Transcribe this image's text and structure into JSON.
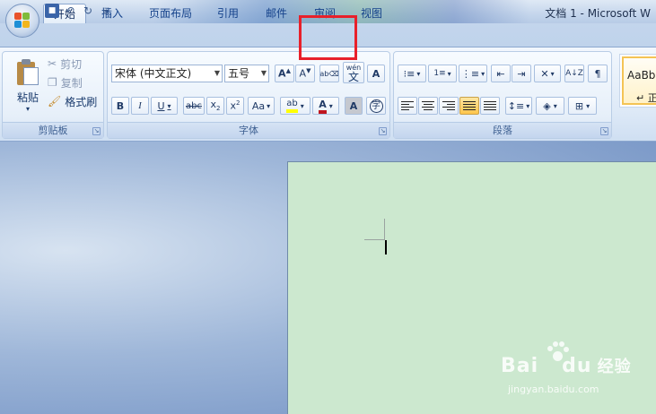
{
  "window": {
    "title": "文档 1 - Microsoft W"
  },
  "tabs": [
    {
      "label": "开始",
      "active": true
    },
    {
      "label": "插入"
    },
    {
      "label": "页面布局"
    },
    {
      "label": "引用"
    },
    {
      "label": "邮件"
    },
    {
      "label": "审阅",
      "highlighted": true
    },
    {
      "label": "视图"
    }
  ],
  "clipboard": {
    "paste": "粘贴",
    "cut": "剪切",
    "copy": "复制",
    "format_painter": "格式刷",
    "group_label": "剪贴板"
  },
  "font": {
    "font_name": "宋体 (中文正文)",
    "font_size": "五号",
    "wen": "wén",
    "wen_char": "文",
    "case_label": "Aa",
    "group_label": "字体"
  },
  "paragraph": {
    "group_label": "段落"
  },
  "styles": {
    "sample": "AaBbC",
    "name": "↵ 正"
  },
  "watermark": {
    "brand": "Bai",
    "brand2": "du",
    "cn": "经验",
    "url": "jingyan.baidu.com"
  },
  "colors": {
    "highlight_box": "#e8202a",
    "page": "#cce8cf",
    "font_color": "#c0161f",
    "highlight_color": "#ffff00"
  }
}
